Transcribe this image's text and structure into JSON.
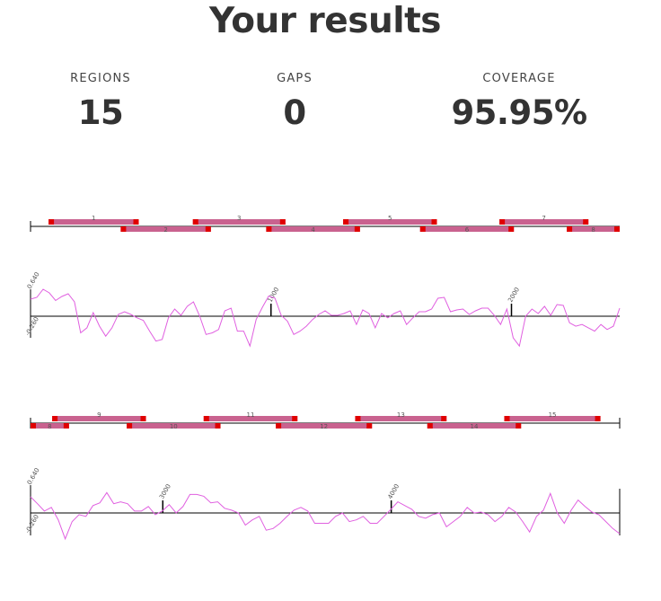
{
  "page": {
    "title": "Your results"
  },
  "stats": {
    "regions": {
      "label": "REGIONS",
      "value": "15"
    },
    "gaps": {
      "label": "GAPS",
      "value": "0"
    },
    "coverage": {
      "label": "COVERAGE",
      "value": "95.95%"
    }
  },
  "colors": {
    "region_fill": "#c9628f",
    "region_end": "#e00000",
    "signal_line": "#e060e0",
    "axis": "#000000"
  },
  "panels": [
    {
      "start": 0,
      "end": 2450,
      "regions": [
        {
          "id": "1",
          "start": 75,
          "end": 450,
          "lane": 0
        },
        {
          "id": "2",
          "start": 375,
          "end": 750,
          "lane": 1
        },
        {
          "id": "3",
          "start": 675,
          "end": 1060,
          "lane": 0
        },
        {
          "id": "4",
          "start": 980,
          "end": 1370,
          "lane": 1
        },
        {
          "id": "5",
          "start": 1300,
          "end": 1690,
          "lane": 0
        },
        {
          "id": "6",
          "start": 1620,
          "end": 2010,
          "lane": 1
        },
        {
          "id": "7",
          "start": 1950,
          "end": 2320,
          "lane": 0
        },
        {
          "id": "8",
          "start": 2230,
          "end": 2450,
          "lane": 1
        }
      ],
      "signal": {
        "ymax_label": "0.640",
        "ymin_label": "-0.260",
        "ticks": [
          "1000",
          "2000"
        ],
        "tick_positions": [
          1000,
          2000
        ],
        "values": [
          0.38,
          0.42,
          0.6,
          0.52,
          0.35,
          0.44,
          0.5,
          0.32,
          -0.2,
          -0.14,
          0.08,
          -0.12,
          -0.24,
          -0.14,
          0.04,
          0.1,
          0.04,
          -0.02,
          -0.05,
          -0.18,
          -0.3,
          -0.28,
          -0.02,
          0.16,
          0.02,
          0.22,
          0.32,
          0.0,
          -0.22,
          -0.2,
          -0.16,
          0.12,
          0.18,
          -0.18,
          -0.18,
          -0.36,
          -0.04,
          0.2,
          0.45,
          0.4,
          0.02,
          -0.06,
          -0.22,
          -0.18,
          -0.12,
          -0.04,
          0.04,
          0.12,
          0.02,
          0.02,
          0.06,
          0.12,
          -0.1,
          0.14,
          0.06,
          -0.14,
          0.06,
          -0.02,
          0.06,
          0.12,
          -0.1,
          -0.02,
          0.1,
          0.1,
          0.16,
          0.4,
          0.42,
          0.1,
          0.14,
          0.16,
          0.04,
          0.12,
          0.18,
          0.18,
          0.02,
          -0.1,
          0.16,
          -0.26,
          -0.36,
          0.0,
          0.16,
          0.06,
          0.22,
          0.02,
          0.26,
          0.24,
          -0.08,
          -0.12,
          -0.1,
          -0.14,
          -0.18,
          -0.1,
          -0.16,
          -0.12,
          0.18
        ]
      }
    },
    {
      "start": 2200,
      "end": 4650,
      "regions": [
        {
          "id": "8",
          "start": 2200,
          "end": 2360,
          "lane": 1
        },
        {
          "id": "9",
          "start": 2290,
          "end": 2680,
          "lane": 0
        },
        {
          "id": "10",
          "start": 2600,
          "end": 2990,
          "lane": 1
        },
        {
          "id": "11",
          "start": 2920,
          "end": 3310,
          "lane": 0
        },
        {
          "id": "12",
          "start": 3220,
          "end": 3620,
          "lane": 1
        },
        {
          "id": "13",
          "start": 3550,
          "end": 3930,
          "lane": 0
        },
        {
          "id": "14",
          "start": 3850,
          "end": 4240,
          "lane": 1
        },
        {
          "id": "15",
          "start": 4170,
          "end": 4570,
          "lane": 0
        }
      ],
      "signal": {
        "ymax_label": "0.640",
        "ymin_label": "-0.260",
        "ticks": [
          "3000",
          "4000"
        ],
        "tick_positions": [
          2750,
          3700
        ],
        "values": [
          0.35,
          0.2,
          0.04,
          0.12,
          -0.08,
          -0.3,
          -0.1,
          -0.02,
          -0.04,
          0.16,
          0.22,
          0.44,
          0.2,
          0.24,
          0.2,
          0.04,
          0.04,
          0.14,
          -0.02,
          0.04,
          0.18,
          0.0,
          0.14,
          0.4,
          0.4,
          0.36,
          0.22,
          0.24,
          0.1,
          0.06,
          0.0,
          -0.14,
          -0.08,
          -0.04,
          -0.2,
          -0.18,
          -0.12,
          -0.04,
          0.06,
          0.12,
          0.04,
          -0.12,
          -0.12,
          -0.12,
          -0.04,
          0.0,
          -0.1,
          -0.08,
          -0.04,
          -0.12,
          -0.12,
          -0.04,
          0.08,
          0.24,
          0.16,
          0.08,
          -0.04,
          -0.06,
          -0.02,
          0.0,
          -0.16,
          -0.1,
          -0.04,
          0.12,
          0.0,
          0.02,
          -0.02,
          -0.1,
          -0.04,
          0.12,
          0.02,
          -0.1,
          -0.22,
          -0.04,
          0.06,
          0.42,
          0.0,
          -0.12,
          0.06,
          0.28,
          0.14,
          0.02,
          -0.02,
          -0.1,
          -0.18,
          -0.24
        ]
      }
    }
  ]
}
